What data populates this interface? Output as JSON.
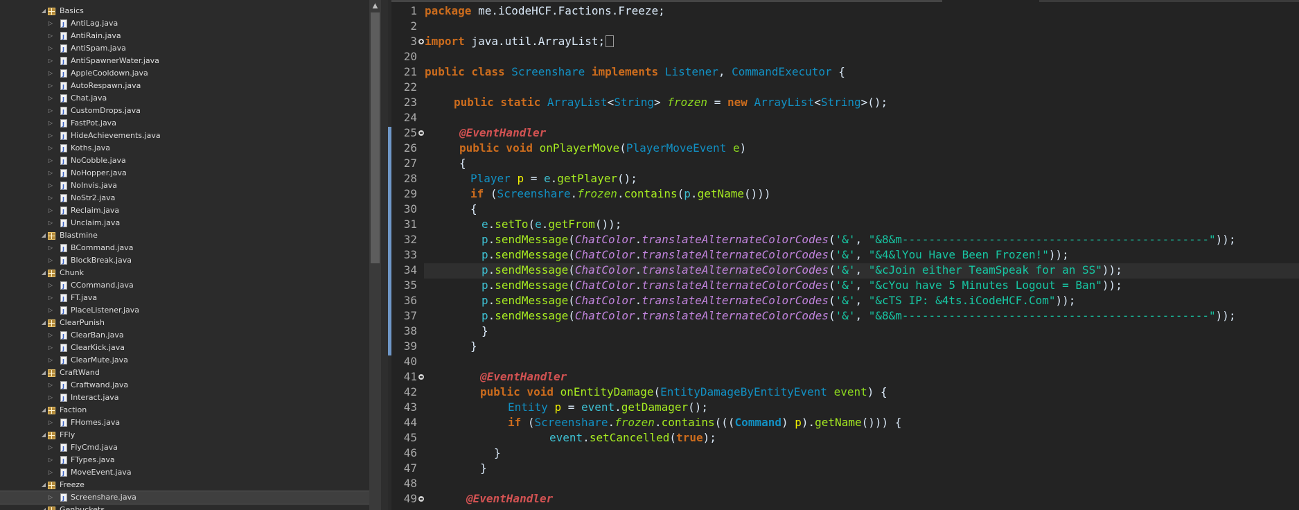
{
  "explorer": {
    "rows": [
      {
        "type": "pkg",
        "label": "Basics"
      },
      {
        "type": "file",
        "label": "AntiLag.java"
      },
      {
        "type": "file",
        "label": "AntiRain.java"
      },
      {
        "type": "file",
        "label": "AntiSpam.java"
      },
      {
        "type": "file",
        "label": "AntiSpawnerWater.java"
      },
      {
        "type": "file",
        "label": "AppleCooldown.java"
      },
      {
        "type": "file",
        "label": "AutoRespawn.java"
      },
      {
        "type": "file",
        "label": "Chat.java"
      },
      {
        "type": "file",
        "label": "CustomDrops.java"
      },
      {
        "type": "file",
        "label": "FastPot.java"
      },
      {
        "type": "file",
        "label": "HideAchievements.java"
      },
      {
        "type": "file",
        "label": "Koths.java"
      },
      {
        "type": "file",
        "label": "NoCobble.java"
      },
      {
        "type": "file",
        "label": "NoHopper.java"
      },
      {
        "type": "file",
        "label": "NoInvis.java"
      },
      {
        "type": "file",
        "label": "NoStr2.java"
      },
      {
        "type": "file",
        "label": "Reclaim.java"
      },
      {
        "type": "file",
        "label": "Unclaim.java"
      },
      {
        "type": "pkg",
        "label": "Blastmine"
      },
      {
        "type": "file",
        "label": "BCommand.java"
      },
      {
        "type": "file",
        "label": "BlockBreak.java"
      },
      {
        "type": "pkg",
        "label": "Chunk"
      },
      {
        "type": "file",
        "label": "CCommand.java"
      },
      {
        "type": "file",
        "label": "FT.java"
      },
      {
        "type": "file",
        "label": "PlaceListener.java"
      },
      {
        "type": "pkg",
        "label": "ClearPunish"
      },
      {
        "type": "file",
        "label": "ClearBan.java"
      },
      {
        "type": "file",
        "label": "ClearKick.java"
      },
      {
        "type": "file",
        "label": "ClearMute.java"
      },
      {
        "type": "pkg",
        "label": "CraftWand"
      },
      {
        "type": "file",
        "label": "Craftwand.java"
      },
      {
        "type": "file",
        "label": "Interact.java"
      },
      {
        "type": "pkg",
        "label": "Faction"
      },
      {
        "type": "file",
        "label": "FHomes.java"
      },
      {
        "type": "pkg",
        "label": "FFly"
      },
      {
        "type": "file",
        "label": "FlyCmd.java"
      },
      {
        "type": "file",
        "label": "FTypes.java"
      },
      {
        "type": "file",
        "label": "MoveEvent.java"
      },
      {
        "type": "pkg",
        "label": "Freeze"
      },
      {
        "type": "file",
        "label": "Screenshare.java",
        "selected": true
      },
      {
        "type": "pkg",
        "label": "Genbuckets"
      }
    ]
  },
  "editor": {
    "lines": [
      {
        "n": "1",
        "fold": "",
        "indent": 0,
        "t": [
          [
            "kw",
            "package"
          ],
          [
            "txt",
            " me.iCodeHCF.Factions.Freeze;"
          ]
        ]
      },
      {
        "n": "2",
        "fold": "",
        "indent": 0,
        "t": []
      },
      {
        "n": "3",
        "fold": "plus",
        "indent": 0,
        "t": [
          [
            "kw",
            "import"
          ],
          [
            "txt",
            " java.util.ArrayList;"
          ],
          [
            "box",
            ""
          ]
        ]
      },
      {
        "n": "20",
        "fold": "",
        "indent": 0,
        "t": []
      },
      {
        "n": "21",
        "fold": "",
        "indent": 0,
        "t": [
          [
            "kw",
            "public class "
          ],
          [
            "ty",
            "Screenshare"
          ],
          [
            "kw",
            " implements "
          ],
          [
            "ty",
            "Listener"
          ],
          [
            "txt",
            ", "
          ],
          [
            "ty",
            "CommandExecutor"
          ],
          [
            "txt",
            " {"
          ]
        ]
      },
      {
        "n": "22",
        "fold": "",
        "indent": 0,
        "t": []
      },
      {
        "n": "23",
        "fold": "",
        "indent": 42,
        "t": [
          [
            "kw",
            "public static "
          ],
          [
            "ty",
            "ArrayList"
          ],
          [
            "txt",
            "<"
          ],
          [
            "ty",
            "String"
          ],
          [
            "txt",
            "> "
          ],
          [
            "sf",
            "frozen"
          ],
          [
            "txt",
            " = "
          ],
          [
            "kw",
            "new "
          ],
          [
            "ty",
            "ArrayList"
          ],
          [
            "txt",
            "<"
          ],
          [
            "ty",
            "String"
          ],
          [
            "txt",
            ">();"
          ]
        ]
      },
      {
        "n": "24",
        "fold": "",
        "indent": 0,
        "t": []
      },
      {
        "n": "25",
        "fold": "minus",
        "indent": 50,
        "t": [
          [
            "ann",
            "@EventHandler"
          ]
        ]
      },
      {
        "n": "26",
        "fold": "",
        "indent": 50,
        "t": [
          [
            "kw",
            "public void "
          ],
          [
            "m",
            "onPlayerMove"
          ],
          [
            "txt",
            "("
          ],
          [
            "ty",
            "PlayerMoveEvent"
          ],
          [
            "txt",
            " "
          ],
          [
            "pc",
            "e"
          ],
          [
            "txt",
            ")"
          ]
        ]
      },
      {
        "n": "27",
        "fold": "",
        "indent": 50,
        "t": [
          [
            "txt",
            "{"
          ]
        ]
      },
      {
        "n": "28",
        "fold": "",
        "indent": 66,
        "t": [
          [
            "ty",
            "Player"
          ],
          [
            "txt",
            " "
          ],
          [
            "lv",
            "p"
          ],
          [
            "txt",
            " = "
          ],
          [
            "sv",
            "e"
          ],
          [
            "txt",
            "."
          ],
          [
            "m",
            "getPlayer"
          ],
          [
            "txt",
            "();"
          ]
        ]
      },
      {
        "n": "29",
        "fold": "",
        "indent": 66,
        "t": [
          [
            "kw",
            "if"
          ],
          [
            "txt",
            " ("
          ],
          [
            "ty",
            "Screenshare"
          ],
          [
            "txt",
            "."
          ],
          [
            "sf",
            "frozen"
          ],
          [
            "txt",
            "."
          ],
          [
            "m",
            "contains"
          ],
          [
            "txt",
            "("
          ],
          [
            "sv",
            "p"
          ],
          [
            "txt",
            "."
          ],
          [
            "m",
            "getName"
          ],
          [
            "txt",
            "()))"
          ]
        ]
      },
      {
        "n": "30",
        "fold": "",
        "indent": 66,
        "t": [
          [
            "txt",
            "{"
          ]
        ]
      },
      {
        "n": "31",
        "fold": "",
        "indent": 82,
        "t": [
          [
            "sv",
            "e"
          ],
          [
            "txt",
            "."
          ],
          [
            "m",
            "setTo"
          ],
          [
            "txt",
            "("
          ],
          [
            "sv",
            "e"
          ],
          [
            "txt",
            "."
          ],
          [
            "m",
            "getFrom"
          ],
          [
            "txt",
            "());"
          ]
        ]
      },
      {
        "n": "32",
        "fold": "",
        "indent": 82,
        "t": [
          [
            "sv",
            "p"
          ],
          [
            "txt",
            "."
          ],
          [
            "m",
            "sendMessage"
          ],
          [
            "txt",
            "("
          ],
          [
            "cc",
            "ChatColor"
          ],
          [
            "txt",
            "."
          ],
          [
            "cc",
            "translateAlternateColorCodes"
          ],
          [
            "txt",
            "("
          ],
          [
            "str",
            "'&'"
          ],
          [
            "txt",
            ", "
          ],
          [
            "str",
            "\"&8&m----------------------------------------------\""
          ],
          [
            "txt",
            "));"
          ]
        ]
      },
      {
        "n": "33",
        "fold": "",
        "indent": 82,
        "t": [
          [
            "sv",
            "p"
          ],
          [
            "txt",
            "."
          ],
          [
            "m",
            "sendMessage"
          ],
          [
            "txt",
            "("
          ],
          [
            "cc",
            "ChatColor"
          ],
          [
            "txt",
            "."
          ],
          [
            "cc",
            "translateAlternateColorCodes"
          ],
          [
            "txt",
            "("
          ],
          [
            "str",
            "'&'"
          ],
          [
            "txt",
            ", "
          ],
          [
            "str",
            "\"&4&lYou Have Been Frozen!\""
          ],
          [
            "txt",
            "));"
          ]
        ]
      },
      {
        "n": "34",
        "fold": "",
        "indent": 82,
        "t": [
          [
            "sv",
            "p"
          ],
          [
            "txt",
            "."
          ],
          [
            "m",
            "sendMessage"
          ],
          [
            "txt",
            "("
          ],
          [
            "cc",
            "ChatColor"
          ],
          [
            "txt",
            "."
          ],
          [
            "cc",
            "translateAlternateColorCodes"
          ],
          [
            "txt",
            "("
          ],
          [
            "str",
            "'&'"
          ],
          [
            "txt",
            ", "
          ],
          [
            "str",
            "\"&cJoin either TeamSpeak for an SS\""
          ],
          [
            "txt",
            "));"
          ]
        ]
      },
      {
        "n": "35",
        "fold": "",
        "indent": 82,
        "t": [
          [
            "sv",
            "p"
          ],
          [
            "txt",
            "."
          ],
          [
            "m",
            "sendMessage"
          ],
          [
            "txt",
            "("
          ],
          [
            "cc",
            "ChatColor"
          ],
          [
            "txt",
            "."
          ],
          [
            "cc",
            "translateAlternateColorCodes"
          ],
          [
            "txt",
            "("
          ],
          [
            "str",
            "'&'"
          ],
          [
            "txt",
            ", "
          ],
          [
            "str",
            "\"&cYou have 5 Minutes Logout = Ban\""
          ],
          [
            "txt",
            "));"
          ]
        ]
      },
      {
        "n": "36",
        "fold": "",
        "indent": 82,
        "t": [
          [
            "sv",
            "p"
          ],
          [
            "txt",
            "."
          ],
          [
            "m",
            "sendMessage"
          ],
          [
            "txt",
            "("
          ],
          [
            "cc",
            "ChatColor"
          ],
          [
            "txt",
            "."
          ],
          [
            "cc",
            "translateAlternateColorCodes"
          ],
          [
            "txt",
            "("
          ],
          [
            "str",
            "'&'"
          ],
          [
            "txt",
            ", "
          ],
          [
            "str",
            "\"&cTS IP: &4ts.iCodeHCF.Com\""
          ],
          [
            "txt",
            "));"
          ]
        ]
      },
      {
        "n": "37",
        "fold": "",
        "indent": 82,
        "t": [
          [
            "sv",
            "p"
          ],
          [
            "txt",
            "."
          ],
          [
            "m",
            "sendMessage"
          ],
          [
            "txt",
            "("
          ],
          [
            "cc",
            "ChatColor"
          ],
          [
            "txt",
            "."
          ],
          [
            "cc",
            "translateAlternateColorCodes"
          ],
          [
            "txt",
            "("
          ],
          [
            "str",
            "'&'"
          ],
          [
            "txt",
            ", "
          ],
          [
            "str",
            "\"&8&m----------------------------------------------\""
          ],
          [
            "txt",
            "));"
          ]
        ]
      },
      {
        "n": "38",
        "fold": "",
        "indent": 82,
        "t": [
          [
            "txt",
            "}"
          ]
        ]
      },
      {
        "n": "39",
        "fold": "",
        "indent": 66,
        "t": [
          [
            "txt",
            "}"
          ]
        ]
      },
      {
        "n": "40",
        "fold": "",
        "indent": 0,
        "t": []
      },
      {
        "n": "41",
        "fold": "minus",
        "indent": 80,
        "t": [
          [
            "ann",
            "@EventHandler"
          ]
        ]
      },
      {
        "n": "42",
        "fold": "",
        "indent": 80,
        "t": [
          [
            "kw",
            "public void "
          ],
          [
            "m",
            "onEntityDamage"
          ],
          [
            "txt",
            "("
          ],
          [
            "ty",
            "EntityDamageByEntityEvent"
          ],
          [
            "txt",
            " "
          ],
          [
            "pc",
            "event"
          ],
          [
            "txt",
            ") {"
          ]
        ]
      },
      {
        "n": "43",
        "fold": "",
        "indent": 120,
        "t": [
          [
            "ty",
            "Entity"
          ],
          [
            "txt",
            " "
          ],
          [
            "lv",
            "p"
          ],
          [
            "txt",
            " = "
          ],
          [
            "sv",
            "event"
          ],
          [
            "txt",
            "."
          ],
          [
            "m",
            "getDamager"
          ],
          [
            "txt",
            "();"
          ]
        ]
      },
      {
        "n": "44",
        "fold": "",
        "indent": 120,
        "t": [
          [
            "kw",
            "if"
          ],
          [
            "txt",
            " ("
          ],
          [
            "ty",
            "Screenshare"
          ],
          [
            "txt",
            "."
          ],
          [
            "sf",
            "frozen"
          ],
          [
            "txt",
            "."
          ],
          [
            "m",
            "contains"
          ],
          [
            "txt",
            "((("
          ],
          [
            "tyb",
            "Command"
          ],
          [
            "txt",
            ") "
          ],
          [
            "lv",
            "p"
          ],
          [
            "txt",
            ")."
          ],
          [
            "m",
            "getName"
          ],
          [
            "txt",
            "())) {"
          ]
        ]
      },
      {
        "n": "45",
        "fold": "",
        "indent": 180,
        "t": [
          [
            "sv",
            "event"
          ],
          [
            "txt",
            "."
          ],
          [
            "m",
            "setCancelled"
          ],
          [
            "txt",
            "("
          ],
          [
            "kw",
            "true"
          ],
          [
            "txt",
            ");"
          ]
        ]
      },
      {
        "n": "46",
        "fold": "",
        "indent": 100,
        "t": [
          [
            "txt",
            "}"
          ]
        ]
      },
      {
        "n": "47",
        "fold": "",
        "indent": 80,
        "t": [
          [
            "txt",
            "}"
          ]
        ]
      },
      {
        "n": "48",
        "fold": "",
        "indent": 0,
        "t": []
      },
      {
        "n": "49",
        "fold": "minus",
        "indent": 60,
        "t": [
          [
            "ann",
            "@EventHandler"
          ]
        ]
      }
    ]
  }
}
